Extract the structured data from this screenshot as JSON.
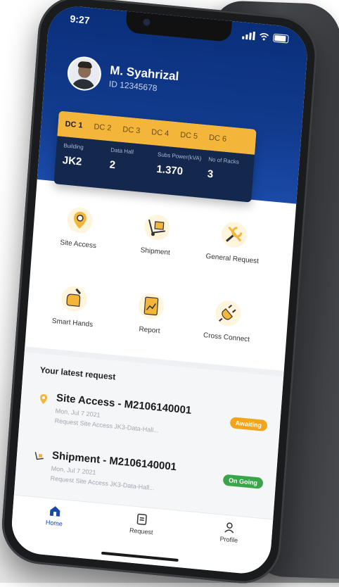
{
  "status_bar": {
    "time": "9:27"
  },
  "profile": {
    "name": "M. Syahrizal",
    "id": "ID 12345678"
  },
  "dc_tabs": [
    "DC 1",
    "DC 2",
    "DC 3",
    "DC 4",
    "DC 5",
    "DC 6"
  ],
  "dc_info": [
    {
      "label": "Building",
      "value": "JK2"
    },
    {
      "label": "Data Hall",
      "value": "2"
    },
    {
      "label": "Subs Power(kVA)",
      "value": "1.370"
    },
    {
      "label": "No of Racks",
      "value": "3"
    }
  ],
  "menu": [
    {
      "label": "Site Access",
      "icon": "location-pin-icon"
    },
    {
      "label": "Shipment",
      "icon": "hand-truck-icon"
    },
    {
      "label": "General Request",
      "icon": "tools-icon"
    },
    {
      "label": "Smart Hands",
      "icon": "hand-wrench-icon"
    },
    {
      "label": "Report",
      "icon": "report-icon"
    },
    {
      "label": "Cross Connect",
      "icon": "plug-icon"
    }
  ],
  "latest": {
    "title": "Your latest request",
    "items": [
      {
        "title": "Site Access - M2106140001",
        "date": "Mon, Jul 7 2021",
        "desc": "Request Site Access JK3-Data-Hall...",
        "status": "Awaiting",
        "status_color": "#f2a51a",
        "icon": "location-pin-icon"
      },
      {
        "title": "Shipment - M2106140001",
        "date": "Mon, Jul 7 2021",
        "desc": "Request Site Access JK3-Data-Hall...",
        "status": "On Going",
        "status_color": "#3aa64a",
        "icon": "hand-truck-icon"
      }
    ]
  },
  "tabs": [
    {
      "label": "Home",
      "icon": "home-icon"
    },
    {
      "label": "Request",
      "icon": "request-icon"
    },
    {
      "label": "Profile",
      "icon": "user-icon"
    }
  ],
  "colors": {
    "brand_blue": "#123b8e",
    "accent_yellow": "#f3b63a"
  }
}
